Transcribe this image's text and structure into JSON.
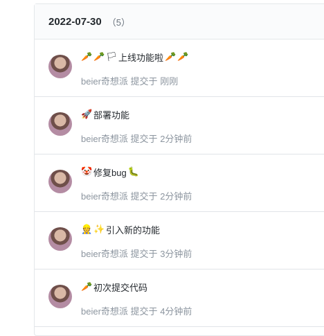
{
  "group": {
    "date": "2022-07-30",
    "count": "（5）"
  },
  "commits": [
    {
      "message": "上线功能啦",
      "prefix_emojis": [
        "🥕",
        "🥕",
        "🏳"
      ],
      "suffix_emojis": [
        "🥕",
        "🥕"
      ],
      "author": "beier奇想派",
      "action": "提交于",
      "time": "刚刚"
    },
    {
      "message": "部署功能",
      "prefix_emojis": [
        "🚀"
      ],
      "suffix_emojis": [],
      "author": "beier奇想派",
      "action": "提交于",
      "time": "2分钟前"
    },
    {
      "message": "修复bug",
      "prefix_emojis": [
        "🤡"
      ],
      "suffix_emojis": [
        "🐛"
      ],
      "author": "beier奇想派",
      "action": "提交于",
      "time": "2分钟前"
    },
    {
      "message": "引入新的功能",
      "prefix_emojis": [
        "👷",
        "✨"
      ],
      "suffix_emojis": [],
      "author": "beier奇想派",
      "action": "提交于",
      "time": "3分钟前"
    },
    {
      "message": "初次提交代码",
      "prefix_emojis": [
        "🥕"
      ],
      "suffix_emojis": [],
      "author": "beier奇想派",
      "action": "提交于",
      "time": "4分钟前"
    }
  ]
}
